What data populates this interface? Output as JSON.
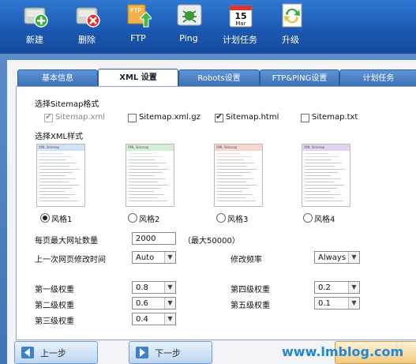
{
  "toolbar": {
    "items": [
      {
        "label": "新建",
        "icon": "new-add-icon"
      },
      {
        "label": "删除",
        "icon": "delete-icon"
      },
      {
        "label": "FTP",
        "icon": "ftp-upload-icon"
      },
      {
        "label": "Ping",
        "icon": "ping-bug-icon"
      },
      {
        "label": "计划任务",
        "icon": "calendar-icon",
        "calendar_day": "15",
        "calendar_month": "Mar"
      },
      {
        "label": "升级",
        "icon": "upgrade-icon"
      }
    ]
  },
  "tabs": [
    "基本信息",
    "XML 设置",
    "Robots设置",
    "FTP&PING设置",
    "计划任务"
  ],
  "active_tab": "XML 设置",
  "sitemap_format": {
    "heading": "选择Sitemap格式",
    "options": [
      {
        "label": "Sitemap.xml",
        "checked": true,
        "disabled": true
      },
      {
        "label": "Sitemap.xml.gz",
        "checked": false,
        "disabled": false
      },
      {
        "label": "Sitemap.html",
        "checked": true,
        "disabled": false
      },
      {
        "label": "Sitemap.txt",
        "checked": false,
        "disabled": false
      }
    ]
  },
  "xml_style": {
    "heading": "选择XML样式",
    "options": [
      {
        "label": "风格1",
        "selected": true,
        "color": "#cfe2f7",
        "thumb_title": "XML Sitemap"
      },
      {
        "label": "风格2",
        "selected": false,
        "color": "#d4f0d4",
        "thumb_title": "XML Sitemap"
      },
      {
        "label": "风格3",
        "selected": false,
        "color": "#f7d6cc",
        "thumb_title": "XML Sitemap"
      },
      {
        "label": "风格4",
        "selected": false,
        "color": "#e4d4f2",
        "thumb_title": "XML Sitemap"
      }
    ]
  },
  "settings": {
    "max_urls_label": "每页最大网址数量",
    "max_urls_value": "2000",
    "max_urls_hint": "（最大50000）",
    "last_modified_label": "上一次网页修改时间",
    "last_modified_value": "Auto",
    "change_freq_label": "修改频率",
    "change_freq_value": "Always",
    "priority1_label": "第一级权重",
    "priority1_value": "0.8",
    "priority2_label": "第二级权重",
    "priority2_value": "0.6",
    "priority3_label": "第三级权重",
    "priority3_value": "0.4",
    "priority4_label": "第四级权重",
    "priority4_value": "0.2",
    "priority5_label": "第五级权重",
    "priority5_value": "0.1"
  },
  "nav": {
    "prev_label": "上一步",
    "next_label": "下一步"
  },
  "watermark": "www.lmblog.com"
}
